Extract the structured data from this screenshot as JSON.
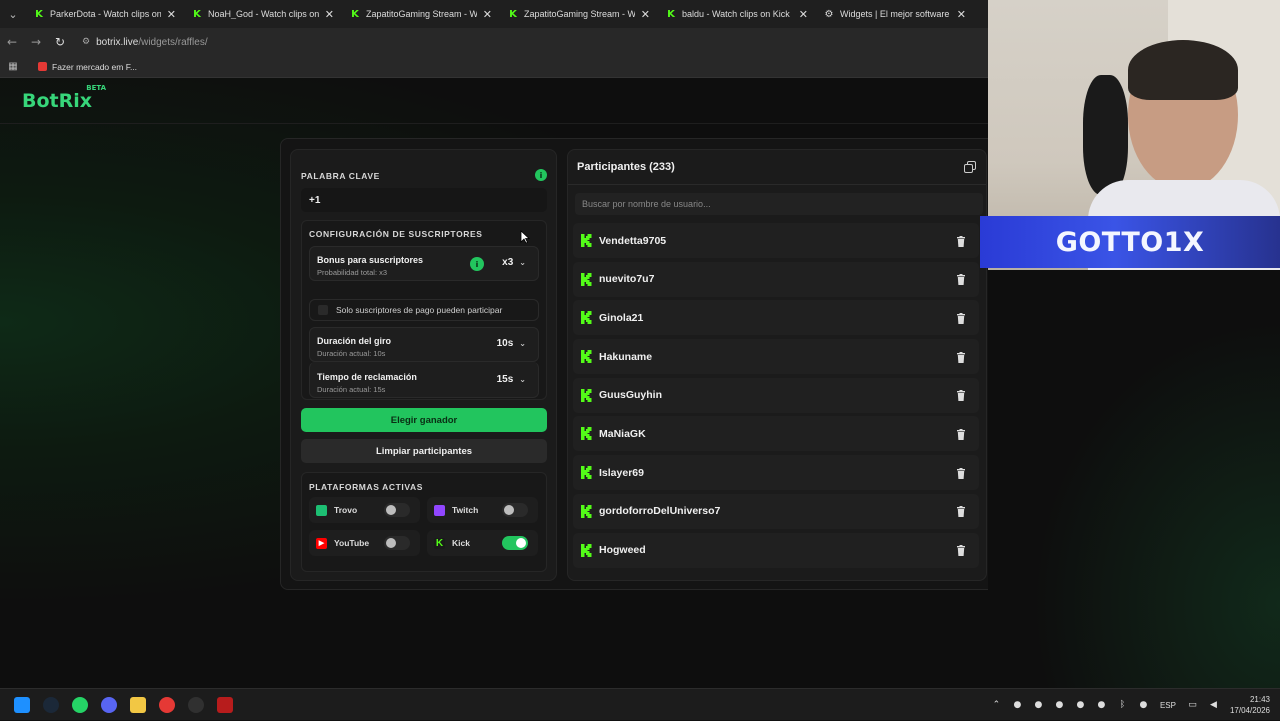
{
  "browser": {
    "tabs": [
      {
        "title": "ParkerDota - Watch clips on Kick",
        "icon": "kick-icon"
      },
      {
        "title": "NoaH_God - Watch clips on Kick",
        "icon": "kick-icon"
      },
      {
        "title": "ZapatitoGaming Stream - Watch",
        "icon": "kick-icon"
      },
      {
        "title": "ZapatitoGaming Stream - Watch",
        "icon": "kick-icon"
      },
      {
        "title": "baldu - Watch clips on Kick",
        "icon": "kick-icon"
      },
      {
        "title": "Widgets | El mejor software pa",
        "icon": "botrix-icon"
      }
    ],
    "url_host": "botrix.live",
    "url_path": "/widgets/raffles/",
    "bookmark": "Fazer mercado em F..."
  },
  "site": {
    "logo": "BotRix",
    "logo_badge": "BETA"
  },
  "raffle": {
    "keyword_label": "PALABRA CLAVE",
    "keyword_value": "+1",
    "subs_section": "CONFIGURACIÓN DE SUSCRIPTORES",
    "bonus": {
      "title": "Bonus para suscriptores",
      "subtitle": "Probabilidad total: x3",
      "value": "x3"
    },
    "paid_only": "Solo suscriptores de pago pueden participar",
    "spin": {
      "title": "Duración del giro",
      "subtitle": "Duración actual: 10s",
      "value": "10s"
    },
    "claim": {
      "title": "Tiempo de reclamación",
      "subtitle": "Duración actual: 15s",
      "value": "15s"
    },
    "pick_winner": "Elegir ganador",
    "clear_participants": "Limpiar participantes",
    "platforms_label": "PLATAFORMAS ACTIVAS",
    "platforms": [
      {
        "name": "Trovo",
        "enabled": false,
        "color": "#1dbf73"
      },
      {
        "name": "Twitch",
        "enabled": false,
        "color": "#9146ff"
      },
      {
        "name": "YouTube",
        "enabled": false,
        "color": "#ff0000"
      },
      {
        "name": "Kick",
        "enabled": true,
        "color": "#53fc18"
      }
    ]
  },
  "participants": {
    "title": "Participantes (233)",
    "search_placeholder": "Buscar por nombre de usuario...",
    "list": [
      "Vendetta9705",
      "nuevito7u7",
      "Ginola21",
      "Hakuname",
      "GuusGuyhin",
      "MaNiaGK",
      "Islayer69",
      "gordoforroDelUniverso7",
      "Hogweed"
    ]
  },
  "stream": {
    "banner": "GOTTO1X"
  },
  "taskbar": {
    "lang": "ESP",
    "time": "21:43",
    "date": "17/04/2026"
  },
  "colors": {
    "accent": "#22c55e",
    "kick": "#53fc18"
  }
}
